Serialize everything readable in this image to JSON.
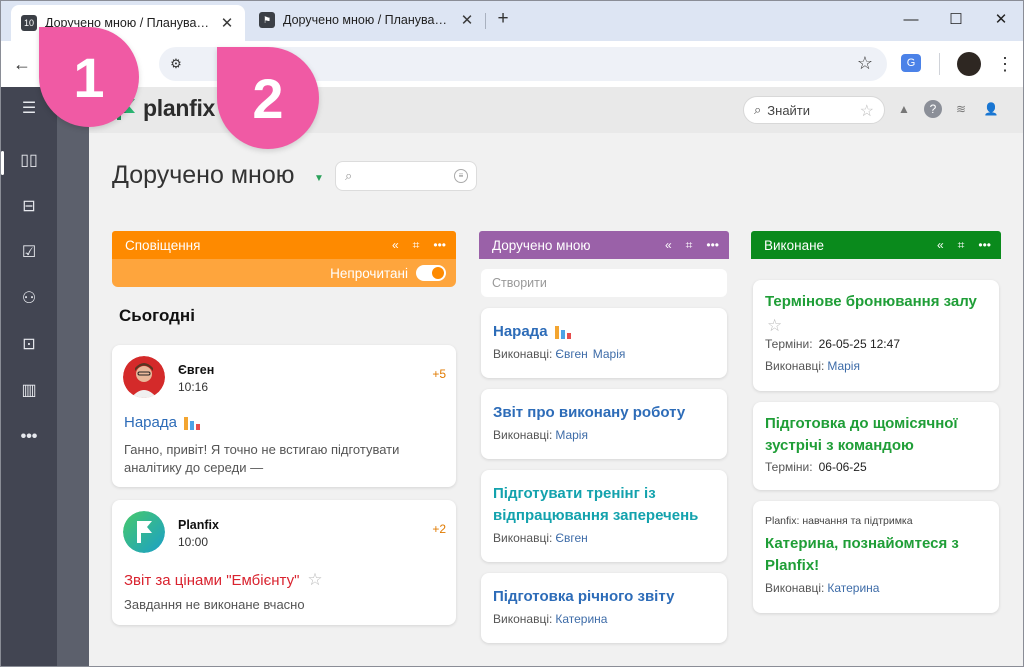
{
  "browser": {
    "tabs": [
      {
        "favicon": "10",
        "title": "Доручено мною / Планувальн",
        "active": true
      },
      {
        "favicon": "flag-icon",
        "title": "Доручено мною / Планувальн",
        "active": false
      }
    ],
    "new_tab": "+",
    "window": {
      "minimize": "—",
      "maximize": "☐",
      "close": "✕"
    }
  },
  "callouts": {
    "one": "1",
    "two": "2",
    "color": "#f05aa4"
  },
  "app": {
    "logo": "planfix",
    "search_label": "Знайти",
    "page_title": "Доручено мною"
  },
  "columns": {
    "notifications": {
      "title": "Сповіщення",
      "color": "#fe8a00",
      "unread_label": "Непрочитані",
      "today_label": "Сьогодні",
      "cards": [
        {
          "author": "Євген",
          "time": "10:16",
          "count": "+5",
          "title": "Нарада",
          "text": "Ганно, привіт! Я точно не встигаю підготувати аналітику до середи —"
        },
        {
          "author": "Planfix",
          "time": "10:00",
          "count": "+2",
          "title": "Звіт за цінами \"Ембієнту\"",
          "text": "Завдання не виконане вчасно"
        }
      ]
    },
    "assigned": {
      "title": "Доручено мною",
      "color": "#9a61a8",
      "create_placeholder": "Створити",
      "cards": [
        {
          "name": "Нарада",
          "label": "Виконавці:",
          "assignees": [
            "Євген",
            "Марія"
          ]
        },
        {
          "name": "Звіт про виконану роботу",
          "label": "Виконавці:",
          "assignees": [
            "Марія"
          ]
        },
        {
          "name": "Підготувати тренінг із відпрацювання заперечень",
          "label": "Виконавці:",
          "assignees": [
            "Євген"
          ]
        },
        {
          "name": "Підготовка річного звіту",
          "label": "Виконавці:",
          "assignees": [
            "Катерина"
          ]
        }
      ]
    },
    "done": {
      "title": "Виконане",
      "color": "#0a8a1c",
      "cards": [
        {
          "name": "Термінове бронювання залу",
          "deadline_label": "Терміни:",
          "deadline": "26-05-25 12:47",
          "label": "Виконавці:",
          "assignees": [
            "Марія"
          ]
        },
        {
          "name": "Підготовка до щомісячної зустрічі з командою",
          "deadline_label": "Терміни:",
          "deadline": "06-06-25"
        },
        {
          "tag": "Planfix: навчання та підтримка",
          "name": "Катерина, познайомтеся з Planfix!",
          "label": "Виконавці:",
          "assignees": [
            "Катерина"
          ]
        }
      ]
    }
  }
}
